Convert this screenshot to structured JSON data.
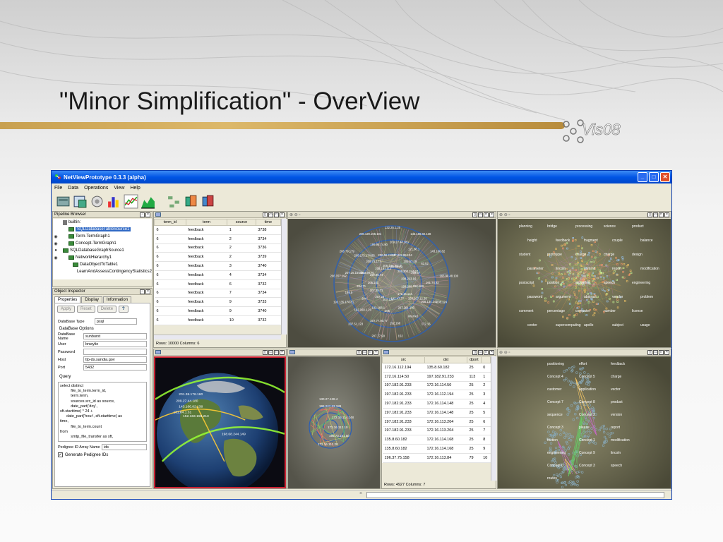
{
  "slide": {
    "title": "\"Minor Simplification\" - OverView",
    "logo_text": "Vis08"
  },
  "window": {
    "title": "NetViewPrototype 0.3.3 (alpha)",
    "menu": [
      "File",
      "Data",
      "Operations",
      "View",
      "Help"
    ]
  },
  "pipeline": {
    "header": "Pipeline Browser",
    "items": [
      {
        "label": "builtin:",
        "indent": 0,
        "selected": false
      },
      {
        "label": "SQLDatabaseTableSource1",
        "indent": 1,
        "selected": true
      },
      {
        "label": "Term-TermGraph1",
        "indent": 2,
        "selected": false
      },
      {
        "label": "Concept-TermGraph1",
        "indent": 2,
        "selected": false
      },
      {
        "label": "SQLDatabaseGraphSource1",
        "indent": 1,
        "selected": false
      },
      {
        "label": "NetworkHierarchy1",
        "indent": 2,
        "selected": false
      },
      {
        "label": "DataObjectToTable1",
        "indent": 2,
        "selected": false
      },
      {
        "label": "LearnAndAssessContingencyStatistics2",
        "indent": 3,
        "selected": false
      }
    ]
  },
  "inspector": {
    "header": "Object Inspector",
    "tabs": [
      "Properties",
      "Display",
      "Information"
    ],
    "buttons": {
      "apply": "Apply",
      "reset": "Reset",
      "delete": "Delete"
    },
    "db_type_label": "DataBase Type",
    "db_type_value": "psql",
    "options_group": "DataBase Options",
    "fields": [
      {
        "label": "DataBase Name",
        "value": "sunburst"
      },
      {
        "label": "User",
        "value": "bnwylie"
      },
      {
        "label": "Password",
        "value": ""
      },
      {
        "label": "Host",
        "value": "tlp-ds.sandia.gov"
      },
      {
        "label": "Port",
        "value": "5432"
      }
    ],
    "query_group": "Query",
    "query_text": "select distinct\n          file_to_term.term_id,\n          term.term,\n          sources.src_id as source,\n          date_part('doy',\nsft.starttime) * 24 +\n      date_part('hour', sft.starttime) as\ntime,\n          file_to_term.count\nfrom\n          smtp_file_transfer as sft,",
    "pedigree_label": "Pedigree ID Array Name",
    "pedigree_value": "ids",
    "generate_label": "Generate Pedigree IDs"
  },
  "table1": {
    "columns": [
      "term_id",
      "term",
      "source",
      "time"
    ],
    "rows": [
      [
        "6",
        "feedback",
        "1",
        "3738"
      ],
      [
        "6",
        "feedback",
        "2",
        "3734"
      ],
      [
        "6",
        "feedback",
        "2",
        "3736"
      ],
      [
        "6",
        "feedback",
        "2",
        "3739"
      ],
      [
        "6",
        "feedback",
        "3",
        "3740"
      ],
      [
        "6",
        "feedback",
        "4",
        "3734"
      ],
      [
        "6",
        "feedback",
        "6",
        "3732"
      ],
      [
        "6",
        "feedback",
        "7",
        "3734"
      ],
      [
        "6",
        "feedback",
        "9",
        "3733"
      ],
      [
        "6",
        "feedback",
        "9",
        "3740"
      ],
      [
        "6",
        "feedback",
        "10",
        "3732"
      ]
    ],
    "status": "Rows: 10000 Columns: 6"
  },
  "table2": {
    "columns": [
      "src",
      "dst",
      "dport",
      ""
    ],
    "rows": [
      [
        "172.16.112.194",
        "135.8.60.182",
        "25",
        "0"
      ],
      [
        "172.16.114.50",
        "197.182.91.233",
        "113",
        "1"
      ],
      [
        "197.182.91.233",
        "172.16.114.50",
        "25",
        "2"
      ],
      [
        "197.182.91.233",
        "172.16.112.194",
        "25",
        "3"
      ],
      [
        "197.182.91.233",
        "172.16.114.148",
        "25",
        "4"
      ],
      [
        "197.182.91.233",
        "172.16.114.148",
        "25",
        "5"
      ],
      [
        "197.182.91.233",
        "172.16.113.204",
        "25",
        "6"
      ],
      [
        "197.182.91.233",
        "172.16.113.204",
        "25",
        "7"
      ],
      [
        "135.8.60.182",
        "172.16.114.168",
        "25",
        "8"
      ],
      [
        "135.8.60.182",
        "172.16.114.168",
        "25",
        "9"
      ],
      [
        "196.37.75.158",
        "172.16.113.84",
        "79",
        "10"
      ]
    ],
    "status": "Rows: 4927 Columns: 7"
  },
  "radial": {
    "labels": [
      "132.25.1.25",
      "209.27.44.180",
      "137.245.85.134",
      "62.52.69",
      "143.166.82.138",
      "121.88.1",
      "209.67.19",
      "208.200.244.67",
      "143.166.82",
      "62.52",
      "209.67",
      "208.213.16",
      "165.90.48.100",
      "161.74.92",
      "152.163",
      "128.209",
      "208.124",
      "208.134.241",
      "169.207.12.38",
      "172.16.114.",
      "172.16",
      "internet",
      "207.201.105",
      "192.47.77",
      "152",
      "192.168",
      "206",
      "207.124",
      "207.77.90",
      "207.77.90.77",
      "192.168.1",
      "207.25",
      "207.51.123",
      "192.168.1.20",
      "204",
      "207.25.71",
      "193.135.174.81",
      "199.5",
      "204.71",
      "205.181",
      "206.157.192",
      "207.25.157.10",
      "198.3.98.70",
      "199.95.74",
      "206.79.179",
      "208.175.174.85",
      "208.71.177",
      "208.181.112",
      "206.129.166.101",
      "199.95.74.90",
      "206.66.240.2",
      "206.184.311.4"
    ]
  },
  "globe": {
    "labels": [
      "201.38.178.160",
      "209.27.44.180",
      "198.68.244.149",
      "143.166.82.138",
      "131.84.1.31",
      "152.163.159.213"
    ]
  },
  "small_radial": {
    "labels": [
      "130.27.128.4",
      "196.227.33.189",
      "172.16.114.148",
      "172.16.112.10",
      "195.73.151.50",
      "172.16.112.20"
    ]
  },
  "term_graph": {
    "labels": [
      "planning",
      "bridge",
      "processing",
      "science",
      "product",
      "height",
      "feedback",
      "fragment",
      "couple",
      "balance",
      "student",
      "prototype",
      "charge",
      "charge",
      "design",
      "parameter",
      "lincoln",
      "commit",
      "report",
      "modification",
      "postscript",
      "position",
      "algorithm",
      "speech",
      "engineering",
      "password",
      "argument",
      "abstract",
      "vendor",
      "problem",
      "comment",
      "percentage",
      "computer",
      "number",
      "license",
      "center",
      "supercomputing",
      "apollo",
      "subject",
      "usage"
    ]
  },
  "concept_graph": {
    "labels": [
      "positioning",
      "effort",
      "feedback",
      "Concept 4",
      "Concept 5",
      "charge",
      "customer",
      "application",
      "vector",
      "Concept 7",
      "Concept 8",
      "product",
      "sequence",
      "Concept 2",
      "version",
      "Concept 3",
      "please",
      "report",
      "friction",
      "Concept 1",
      "modification",
      "engineering",
      "Concept 9",
      "lincoln",
      "Concept 0",
      "Concept 3",
      "speech",
      "routes"
    ]
  }
}
